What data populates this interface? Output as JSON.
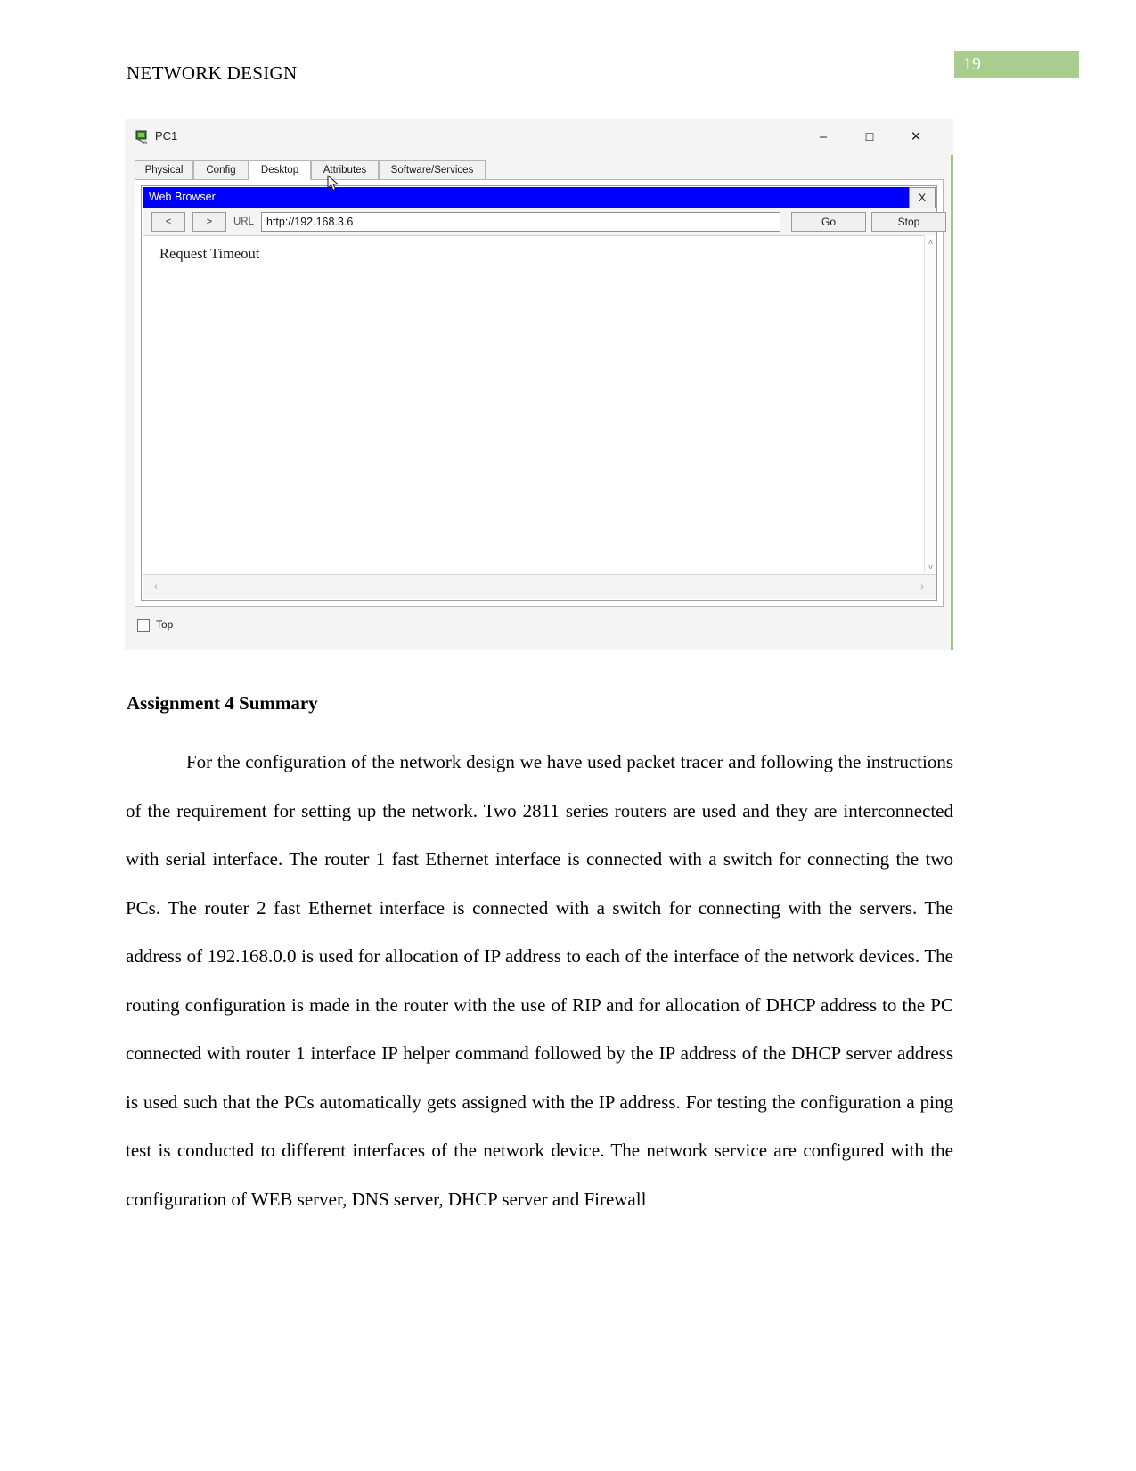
{
  "document": {
    "running_head": "NETWORK DESIGN",
    "page_number": "19",
    "accent_color": "#a8cd8e",
    "section_heading": "Assignment 4 Summary",
    "summary_paragraph": "For the configuration of the network design we have used packet tracer and following the instructions of the requirement for setting up the network. Two 2811 series routers are used and they are interconnected with serial interface. The router 1 fast Ethernet interface is connected with a switch for connecting the two PCs. The router 2 fast Ethernet interface is connected with a switch for connecting with the servers. The address of 192.168.0.0 is used for allocation of IP address to each of the interface of the network devices. The routing configuration is made in the router with the use of RIP and for allocation of DHCP address to the PC connected with router 1 interface IP helper command followed by the IP address of the DHCP server address is used such that the PCs automatically gets assigned with the IP address. For testing the configuration a ping test is conducted to different interfaces of the network device. The network service are configured with the configuration of WEB server, DNS server, DHCP server and Firewall"
  },
  "screenshot": {
    "window": {
      "title": "PC1",
      "device_icon": "pc-device-icon",
      "controls": {
        "minimize": "–",
        "maximize": "☐",
        "close": "✕"
      }
    },
    "tabs": [
      {
        "label": "Physical",
        "active": false
      },
      {
        "label": "Config",
        "active": false
      },
      {
        "label": "Desktop",
        "active": true
      },
      {
        "label": "Attributes",
        "active": false
      },
      {
        "label": "Software/Services",
        "active": false
      }
    ],
    "web_browser": {
      "title": "Web Browser",
      "title_bar_color": "#0000ff",
      "close_label": "X",
      "back_label": "<",
      "forward_label": ">",
      "url_label": "URL",
      "url_value": "http://192.168.3.6",
      "go_label": "Go",
      "stop_label": "Stop",
      "page_content": "Request Timeout",
      "scroll_up": "∧",
      "scroll_down": "∨",
      "scroll_left": "‹",
      "scroll_right": "›"
    },
    "footer": {
      "top_checkbox_label": "Top",
      "top_checkbox_checked": false
    }
  }
}
